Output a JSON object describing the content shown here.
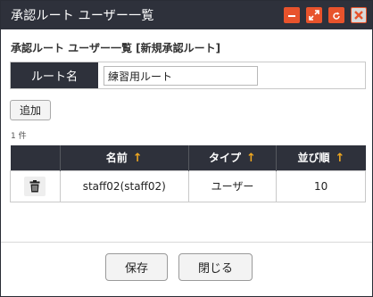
{
  "window": {
    "title": "承認ルート ユーザー一覧",
    "controls": {
      "minimize_icon": "minimize-icon",
      "maximize_icon": "maximize-icon",
      "refresh_icon": "refresh-icon",
      "close_icon": "close-icon",
      "accent_color": "#e8532c"
    }
  },
  "page": {
    "heading": "承認ルート ユーザー一覧 [新規承認ルート]"
  },
  "route": {
    "label": "ルート名",
    "value": "練習用ルート"
  },
  "toolbar": {
    "add_label": "追加"
  },
  "list": {
    "count_text": "1 件",
    "columns": [
      {
        "label": "",
        "sortable": false
      },
      {
        "label": "名前",
        "sortable": true
      },
      {
        "label": "タイプ",
        "sortable": true
      },
      {
        "label": "並び順",
        "sortable": true
      }
    ],
    "rows": [
      {
        "delete_icon": "trash-icon",
        "name": "staff02(staff02)",
        "type": "ユーザー",
        "order": "10"
      }
    ]
  },
  "footer": {
    "save_label": "保存",
    "close_label": "閉じる"
  },
  "colors": {
    "header_bg": "#2e313b",
    "sort_arrow": "#f0a820"
  }
}
